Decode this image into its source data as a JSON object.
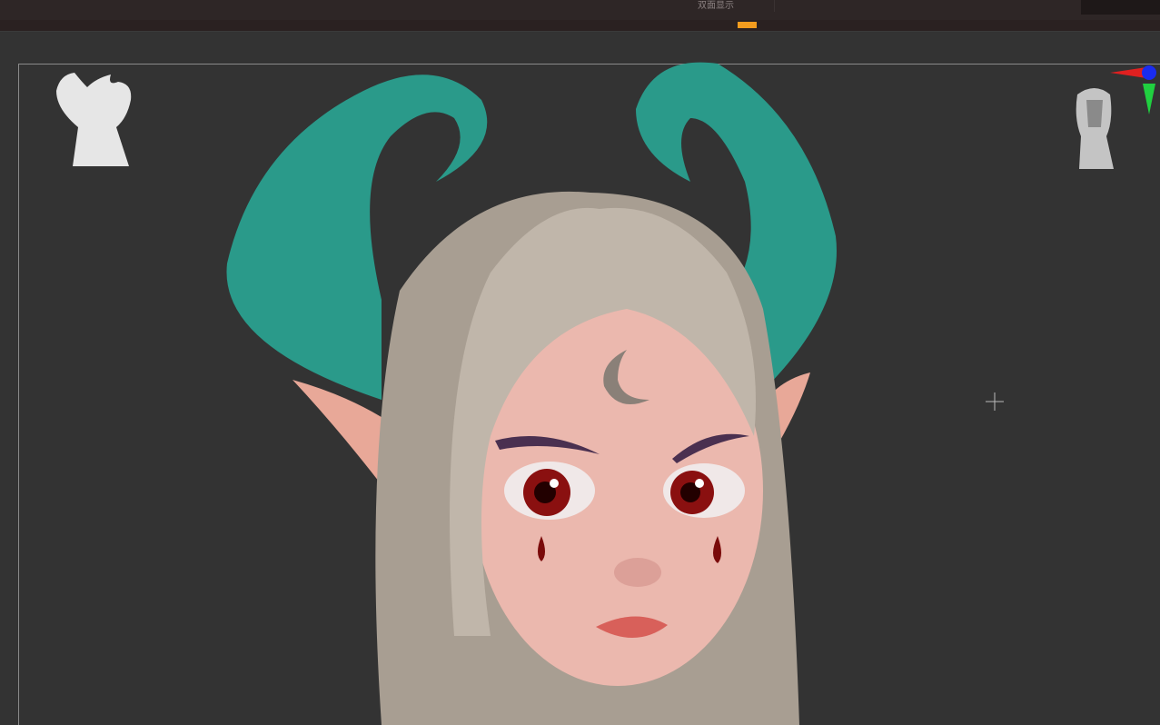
{
  "toolbar": {
    "double_sided_label": "双面显示"
  },
  "colors": {
    "accent": "#f39c1e",
    "background": "#333333",
    "horn": "#2a9a8a",
    "hair": "#b8ada0",
    "skin": "#e8b0a8"
  },
  "icons": [
    "head-silhouette-icon",
    "navigation-head-icon",
    "axis-gizmo-icon",
    "cursor-crosshair-icon"
  ]
}
